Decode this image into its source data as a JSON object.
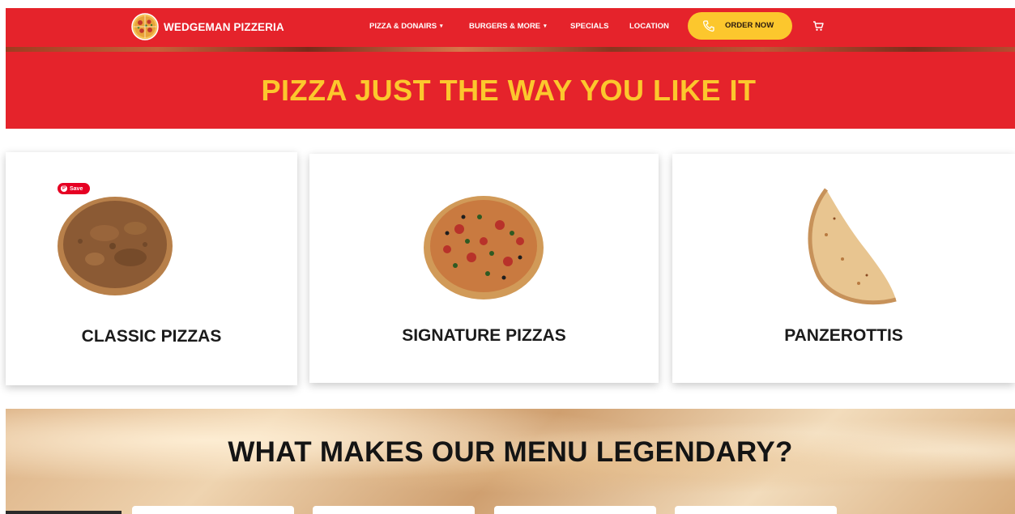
{
  "brand": {
    "name": "WEDGEMAN PIZZERIA"
  },
  "nav": {
    "items": [
      {
        "label": "PIZZA & DONAIRS",
        "caret": "▾"
      },
      {
        "label": "BURGERS & MORE",
        "caret": "▾"
      },
      {
        "label": "SPECIALS",
        "caret": ""
      },
      {
        "label": "LOCATION",
        "caret": ""
      }
    ],
    "order_label": "ORDER NOW"
  },
  "hero": {
    "title": "PIZZA JUST THE WAY YOU LIKE IT"
  },
  "categories": [
    {
      "title": "CLASSIC PIZZAS",
      "save_label": "Save"
    },
    {
      "title": "SIGNATURE PIZZAS"
    },
    {
      "title": "PANZEROTTIS"
    }
  ],
  "legend": {
    "title": "WHAT MAKES OUR MENU LEGENDARY?"
  },
  "colors": {
    "brand_red": "#e5232b",
    "accent_yellow": "#fcc72d",
    "pinterest_red": "#e60023"
  },
  "icons": [
    "pizza-logo-icon",
    "phone-icon",
    "cart-icon",
    "pinterest-icon"
  ]
}
